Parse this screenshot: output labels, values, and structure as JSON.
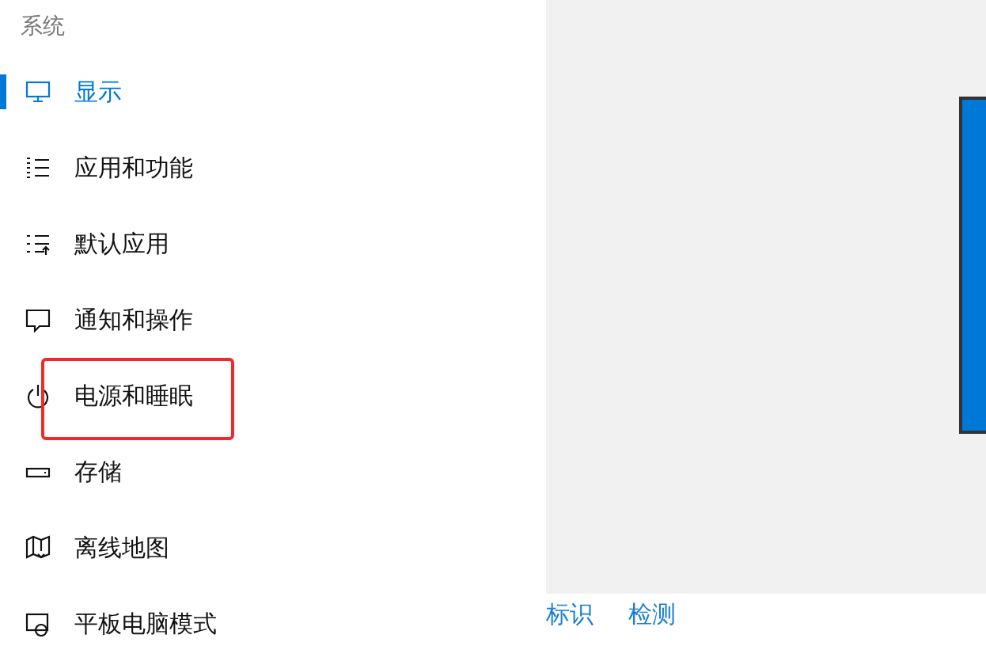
{
  "sidebar": {
    "header": "系统",
    "items": [
      {
        "label": "显示",
        "selected": true,
        "highlighted": false
      },
      {
        "label": "应用和功能",
        "selected": false,
        "highlighted": false
      },
      {
        "label": "默认应用",
        "selected": false,
        "highlighted": false
      },
      {
        "label": "通知和操作",
        "selected": false,
        "highlighted": false
      },
      {
        "label": "电源和睡眠",
        "selected": false,
        "highlighted": true
      },
      {
        "label": "存储",
        "selected": false,
        "highlighted": false
      },
      {
        "label": "离线地图",
        "selected": false,
        "highlighted": false
      },
      {
        "label": "平板电脑模式",
        "selected": false,
        "highlighted": false
      }
    ]
  },
  "display": {
    "links": [
      "标识",
      "检测"
    ]
  }
}
